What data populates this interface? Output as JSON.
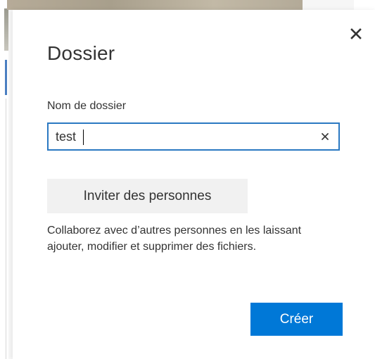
{
  "dialog": {
    "title": "Dossier",
    "close_icon": "close-icon",
    "field": {
      "label": "Nom de dossier",
      "value": "test",
      "clear_icon": "clear-icon"
    },
    "invite_button_label": "Inviter des personnes",
    "help_text": "Collaborez avec d’autres personnes en les laissant ajouter, modifier et supprimer des fichiers.",
    "create_button_label": "Créer"
  },
  "colors": {
    "accent": "#0078d7",
    "focus_border": "#2b79c2",
    "secondary_button": "#f1f1f1",
    "text": "#333333"
  }
}
